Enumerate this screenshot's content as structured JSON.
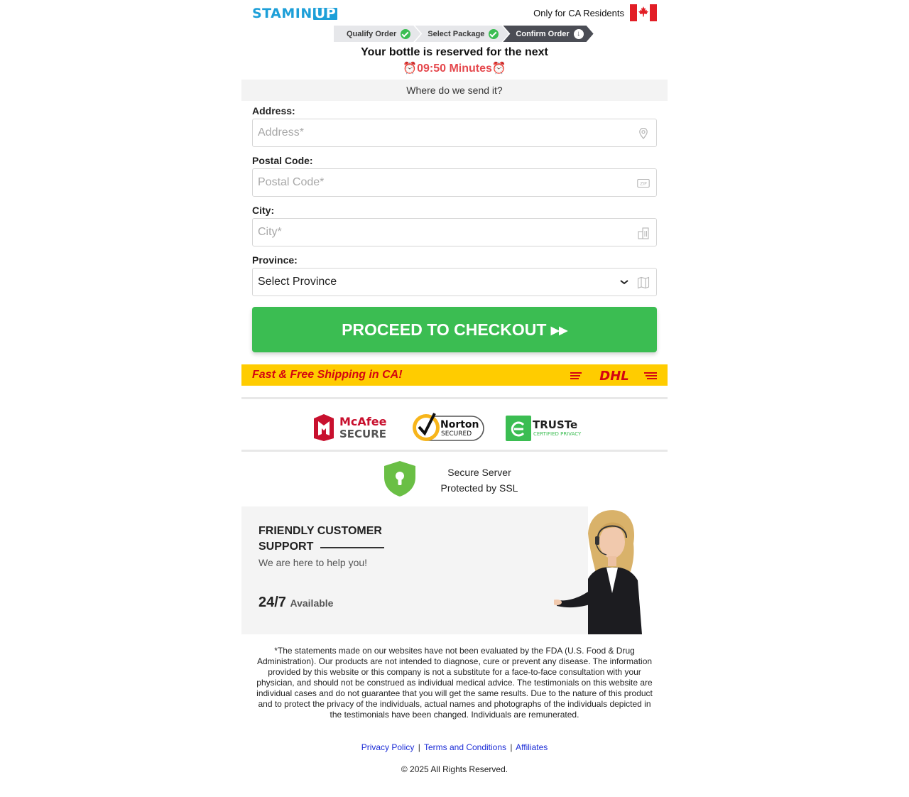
{
  "header": {
    "logo_text": "STAMIN",
    "logo_box_text": "UP",
    "residents_text": "Only for CA Residents"
  },
  "steps": [
    {
      "label": "Qualify Order",
      "status": "done"
    },
    {
      "label": "Select Package",
      "status": "done"
    },
    {
      "label": "Confirm Order",
      "status": "current"
    }
  ],
  "reserve": {
    "text": "Your bottle is reserved for the next",
    "timer_icon": "⏰",
    "timer": "09:50 Minutes"
  },
  "form": {
    "heading": "Where do we send it?",
    "address": {
      "label": "Address:",
      "placeholder": "Address*",
      "icon": "map-pin-icon"
    },
    "postal": {
      "label": "Postal Code:",
      "placeholder": "Postal Code*",
      "icon": "zip-icon",
      "icon_text": "ZIP"
    },
    "city": {
      "label": "City:",
      "placeholder": "City*",
      "icon": "buildings-icon"
    },
    "province": {
      "label": "Province:",
      "selected": "Select Province",
      "icon": "map-icon"
    }
  },
  "cta": {
    "label": "PROCEED TO CHECKOUT ▸▸"
  },
  "shipping": {
    "text": "Fast & Free Shipping in CA!",
    "carrier_logo": "DHL"
  },
  "badges": {
    "mcafee_line1": "McAfee",
    "mcafee_line2": "SECURE",
    "norton_line1": "Norton",
    "norton_line2": "SECURED",
    "truste_line1": "TRUSTe",
    "truste_line2": "CERTIFIED PRIVACY"
  },
  "ssl": {
    "line1": "Secure Server",
    "line2": "Protected by SSL"
  },
  "support": {
    "title_line1": "FRIENDLY CUSTOMER",
    "title_line2": "SUPPORT",
    "subtitle": "We are here to help you!",
    "hours": "24/7",
    "available": "Available"
  },
  "disclaimer": "*The statements made on our websites have not been evaluated by the FDA (U.S. Food & Drug Administration). Our products are not intended to diagnose, cure or prevent any disease. The information provided by this website or this company is not a substitute for a face-to-face consultation with your physician, and should not be construed as individual medical advice. The testimonials on this website are individual cases and do not guarantee that you will get the same results. Due to the nature of this product and to protect the privacy of the individuals, actual names and photographs of the individuals depicted in the testimonials have been changed. Individuals are remunerated.",
  "footer": {
    "links": [
      "Privacy Policy",
      "Terms and Conditions",
      "Affiliates"
    ],
    "separator": "|",
    "copyright": "© 2025 All Rights Reserved."
  },
  "colors": {
    "brand_blue": "#1d9fd8",
    "cta_green": "#3bbd52",
    "timer_red": "#e5484d",
    "dhl_yellow": "#ffcc00",
    "dhl_red": "#d40511"
  }
}
